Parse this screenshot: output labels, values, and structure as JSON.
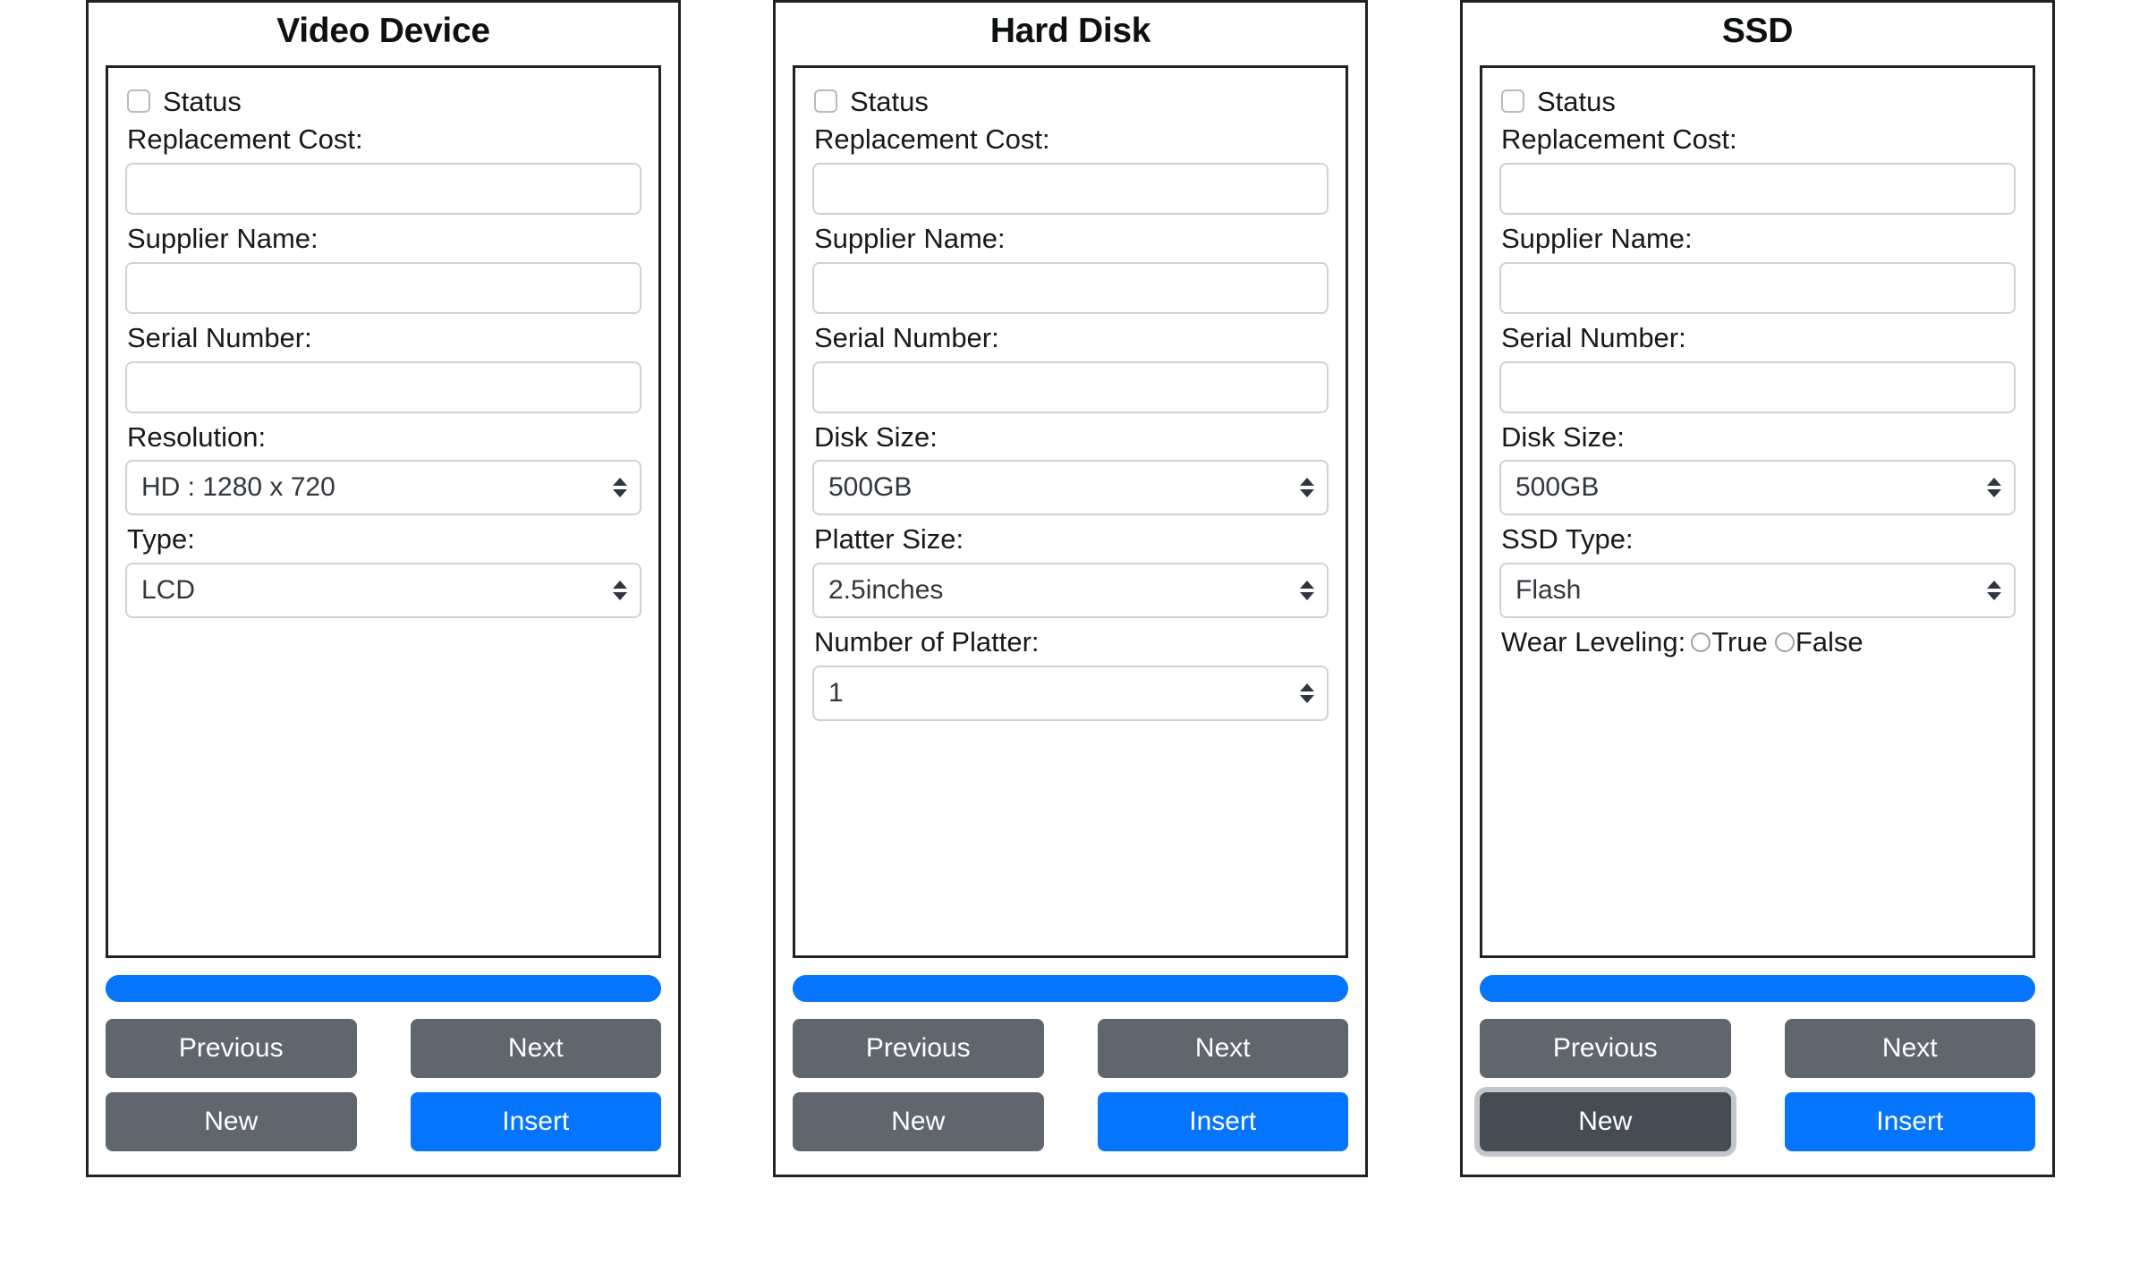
{
  "theme": {
    "accent_blue": "#0575fd",
    "button_gray": "#5f666e",
    "button_gray_focused": "#454c53",
    "focus_ring": "#c3c7cb",
    "panel_border": "#1f2326",
    "control_border": "#ccd2da"
  },
  "common": {
    "status_label": "Status",
    "replacement_cost_label": "Replacement Cost:",
    "supplier_name_label": "Supplier Name:",
    "serial_number_label": "Serial Number:",
    "replacement_cost_value": "",
    "supplier_name_value": "",
    "serial_number_value": "",
    "buttons": {
      "previous": "Previous",
      "next": "Next",
      "new": "New",
      "insert": "Insert"
    }
  },
  "panels": [
    {
      "id": "video-device",
      "title": "Video Device",
      "status_checked": false,
      "fields": [
        {
          "type": "select",
          "name": "resolution",
          "label": "Resolution:",
          "value": "HD : 1280 x 720"
        },
        {
          "type": "select",
          "name": "type",
          "label": "Type:",
          "value": "LCD"
        }
      ],
      "progress_percent": 100,
      "focused_button": null
    },
    {
      "id": "hard-disk",
      "title": "Hard Disk",
      "status_checked": false,
      "fields": [
        {
          "type": "select",
          "name": "disk-size",
          "label": "Disk Size:",
          "value": "500GB"
        },
        {
          "type": "select",
          "name": "platter-size",
          "label": "Platter Size:",
          "value": "2.5inches"
        },
        {
          "type": "select",
          "name": "number-of-platter",
          "label": "Number of Platter:",
          "value": "1"
        }
      ],
      "progress_percent": 100,
      "focused_button": null
    },
    {
      "id": "ssd",
      "title": "SSD",
      "status_checked": false,
      "fields": [
        {
          "type": "select",
          "name": "disk-size",
          "label": "Disk Size:",
          "value": "500GB"
        },
        {
          "type": "select",
          "name": "ssd-type",
          "label": "SSD Type:",
          "value": "Flash"
        },
        {
          "type": "radio",
          "name": "wear-leveling",
          "label": "Wear Leveling:",
          "options": [
            {
              "label": "True",
              "selected": false
            },
            {
              "label": "False",
              "selected": false
            }
          ]
        }
      ],
      "progress_percent": 100,
      "focused_button": "new"
    }
  ]
}
